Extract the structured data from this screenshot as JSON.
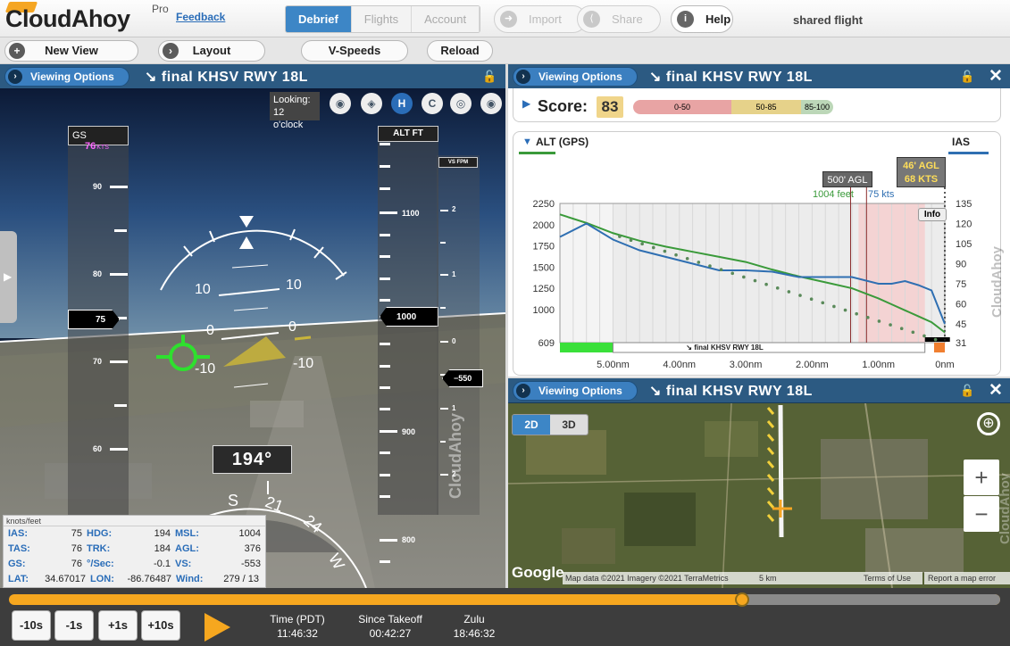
{
  "app": {
    "name": "CloudAhoy",
    "pro_badge": "Pro",
    "feedback": "Feedback"
  },
  "tabs": [
    {
      "label": "Debrief",
      "active": true
    },
    {
      "label": "Flights",
      "active": false
    },
    {
      "label": "Account",
      "active": false
    }
  ],
  "toolbar": {
    "import": "Import",
    "share": "Share",
    "help": "Help",
    "shared": "shared flight"
  },
  "secondary": {
    "new_view": "New View",
    "layout": "Layout",
    "vspeeds": "V-Speeds",
    "reload": "Reload"
  },
  "panels": {
    "left": {
      "viewing_options": "Viewing Options",
      "title": "final KHSV RWY 18L"
    },
    "right_top": {
      "viewing_options": "Viewing Options",
      "title": "final KHSV RWY 18L"
    },
    "right_bottom": {
      "viewing_options": "Viewing Options",
      "title": "final KHSV RWY 18L"
    }
  },
  "pfd": {
    "looking_line1": "Looking:",
    "looking_line2": "12 o'clock",
    "gs_label": "GS",
    "gs_value": "76",
    "gs_unit": "KTS",
    "alt_label": "ALT FT",
    "vs_label": "VS FPM",
    "speed_ticks": [
      "90",
      "80",
      "70",
      "60"
    ],
    "speed_bug": "75",
    "alt_ticks": [
      "1100",
      "900",
      "800"
    ],
    "alt_bug": "1000",
    "vs_ticks": [
      "2",
      "1",
      "0",
      "1",
      "2"
    ],
    "vs_bug": "550",
    "pitch_labels": [
      "10",
      "10",
      "0",
      "0",
      "-10",
      "-10"
    ],
    "heading": "194°",
    "compass": [
      "S",
      "21",
      "24",
      "W"
    ],
    "watermark": "CloudAhoy"
  },
  "data_table": {
    "header": "knots/feet",
    "rows": [
      [
        {
          "k": "IAS:",
          "v": "75"
        },
        {
          "k": "HDG:",
          "v": "194"
        },
        {
          "k": "MSL:",
          "v": "1004"
        }
      ],
      [
        {
          "k": "TAS:",
          "v": "76"
        },
        {
          "k": "TRK:",
          "v": "184"
        },
        {
          "k": "AGL:",
          "v": "376"
        }
      ],
      [
        {
          "k": "GS:",
          "v": "76"
        },
        {
          "k": "°/Sec:",
          "v": "-0.1"
        },
        {
          "k": "VS:",
          "v": "-553"
        }
      ],
      [
        {
          "k": "LAT:",
          "v": "34.67017"
        },
        {
          "k": "LON:",
          "v": "-86.76487"
        },
        {
          "k": "Wind:",
          "v": "279 / 13"
        }
      ]
    ]
  },
  "score": {
    "label": "Score:",
    "value": "83",
    "bands": [
      "0-50",
      "50-85",
      "85-100"
    ]
  },
  "chart_data": {
    "type": "line",
    "title": "ALT (GPS)",
    "right_label": "IAS",
    "xlabel": "",
    "x_ticks": [
      "5.00nm",
      "4.00nm",
      "3.00nm",
      "2.00nm",
      "1.00nm",
      "0nm"
    ],
    "y_ticks_left": [
      "2250",
      "2000",
      "1750",
      "1500",
      "1250",
      "1000",
      "609"
    ],
    "y_ticks_right": [
      "135",
      "120",
      "105",
      "90",
      "75",
      "60",
      "45",
      "31"
    ],
    "ylim": [
      609,
      2250
    ],
    "ylim_right": [
      31,
      135
    ],
    "annotation_500": "500' AGL",
    "annotation_1004": "1004 feet",
    "annotation_75": "75 kts",
    "annotation_46": "46' AGL",
    "annotation_68": "68 KTS",
    "info": "Info",
    "segment_label": "↘ final KHSV RWY 18L",
    "watermark": "CloudAhoy",
    "series": [
      {
        "name": "ALT (GPS)",
        "color": "#3a9a3a",
        "x": [
          5.8,
          5.4,
          5.0,
          4.6,
          4.2,
          3.8,
          3.4,
          3.0,
          2.6,
          2.2,
          1.8,
          1.4,
          1.0,
          0.8,
          0.6,
          0.4,
          0.2,
          0.0
        ],
        "values": [
          2120,
          2020,
          1900,
          1810,
          1740,
          1680,
          1620,
          1560,
          1470,
          1390,
          1320,
          1250,
          1130,
          1060,
          990,
          920,
          850,
          730
        ]
      },
      {
        "name": "IAS",
        "color": "#2f6fb2",
        "x": [
          5.8,
          5.4,
          5.0,
          4.6,
          4.2,
          3.8,
          3.4,
          3.0,
          2.6,
          2.2,
          1.8,
          1.4,
          1.0,
          0.8,
          0.6,
          0.4,
          0.2,
          0.0
        ],
        "values": [
          110,
          120,
          108,
          100,
          95,
          90,
          85,
          85,
          84,
          80,
          80,
          80,
          75,
          75,
          77,
          74,
          70,
          45
        ]
      }
    ]
  },
  "map": {
    "mode_2d": "2D",
    "mode_3d": "3D",
    "google": "Google",
    "attribution": "Map data ©2021 Imagery ©2021 TerraMetrics",
    "scale": "5 km",
    "terms": "Terms of Use",
    "report": "Report a map error",
    "zoom_in": "+",
    "zoom_out": "−",
    "watermark": "CloudAhoy"
  },
  "playback": {
    "buttons": [
      "-10s",
      "-1s",
      "+1s",
      "+10s"
    ],
    "progress": 0.74,
    "time_label": "Time (PDT)",
    "time_value": "11:46:32",
    "since_label": "Since Takeoff",
    "since_value": "00:42:27",
    "zulu_label": "Zulu",
    "zulu_value": "18:46:32"
  }
}
